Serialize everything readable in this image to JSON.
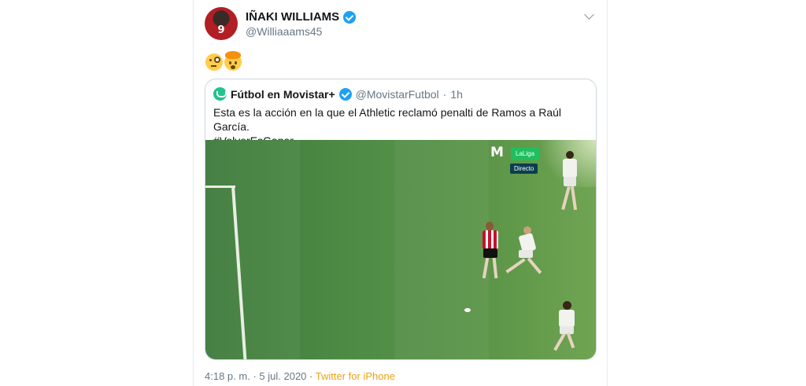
{
  "tweet": {
    "author": {
      "display_name": "IÑAKI WILLIAMS",
      "handle": "@Williaaams45",
      "avatar_number": "9",
      "verified": true
    },
    "body_emojis": [
      "face-with-monocle-emoji",
      "exploding-head-emoji"
    ],
    "quoted": {
      "display_name": "Fútbol en Movistar+",
      "handle": "@MovistarFutbol",
      "separator": "·",
      "time": "1h",
      "verified": true,
      "text_line1": "Esta es la acción en la que el Athletic reclamó penalti de Ramos a Raúl García.",
      "text_line2": "#VolverEsGanar",
      "media": {
        "broadcaster_logo": "M",
        "competition_badge": "LaLiga",
        "live_badge": "Directo"
      }
    },
    "footer": {
      "time": "4:18 p. m.",
      "separator": "·",
      "date": "5 jul. 2020",
      "source": "Twitter for iPhone"
    }
  },
  "colors": {
    "verified_blue": "#1da1f2",
    "source_link": "#e8a317",
    "pitch_green": "#4f8c46",
    "athletic_red": "#c8102e"
  }
}
